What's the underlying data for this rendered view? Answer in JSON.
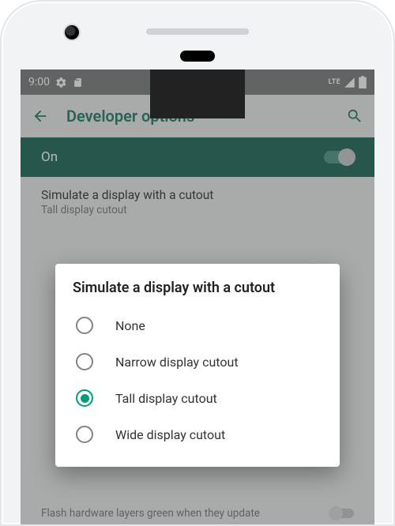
{
  "status": {
    "time": "9:00",
    "lte_label": "LTE"
  },
  "appbar": {
    "title": "Developer options"
  },
  "master_toggle": {
    "label": "On",
    "enabled": true
  },
  "current_setting": {
    "label": "Simulate a display with a cutout",
    "value": "Tall display cutout"
  },
  "dialog": {
    "title": "Simulate a display with a cutout",
    "options": [
      {
        "label": "None",
        "selected": false
      },
      {
        "label": "Narrow display cutout",
        "selected": false
      },
      {
        "label": "Tall display cutout",
        "selected": true
      },
      {
        "label": "Wide display cutout",
        "selected": false
      }
    ]
  },
  "underlay": {
    "text": "Flash hardware layers green when they update"
  },
  "colors": {
    "accent": "#089b7b",
    "appbar_text": "#0e6e5a",
    "toggle_bg": "#0a5b4b"
  }
}
